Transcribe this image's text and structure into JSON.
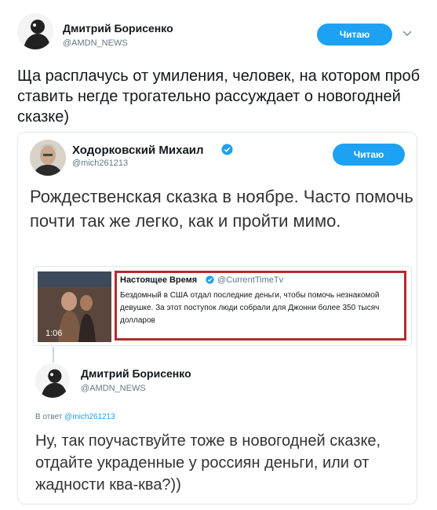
{
  "outer_tweet": {
    "author_name": "Дмитрий Борисенко",
    "author_handle": "@AMDN_NEWS",
    "follow_label": "Читаю",
    "text": "Ща расплачусь от умиления, человек, на котором проб ставить негде трогательно рассуждает о новогодней сказке)"
  },
  "quoted_tweet": {
    "author_name": "Ходорковский Михаил",
    "author_handle": "@mich261213",
    "follow_label": "Читаю",
    "text": "Рождественская сказка в ноябре. Часто помочь почти так же легко, как и пройти мимо."
  },
  "media_card": {
    "source_name": "Настоящее Время",
    "source_handle": "@CurrentTimeTv",
    "text": "Бездомный в США отдал последние деньги, чтобы помочь незнакомой девушке. За этот поступок люди собрали для Джонни более 350 тысяч долларов",
    "duration": "1:06"
  },
  "reply": {
    "author_name": "Дмитрий Борисенко",
    "author_handle": "@AMDN_NEWS",
    "in_reply_label": "В ответ",
    "in_reply_handle": "@mich261213",
    "text": "Ну, так поучаствуйте тоже в новогодней сказке, отдайте украденные у россиян деньги, или от жадности ква-ква?))"
  },
  "colors": {
    "accent": "#1da1f2",
    "highlight_border": "#b42b2b",
    "secondary_text": "#657786"
  },
  "icons": [
    "verified-icon",
    "chevron-down-icon",
    "avatar"
  ]
}
